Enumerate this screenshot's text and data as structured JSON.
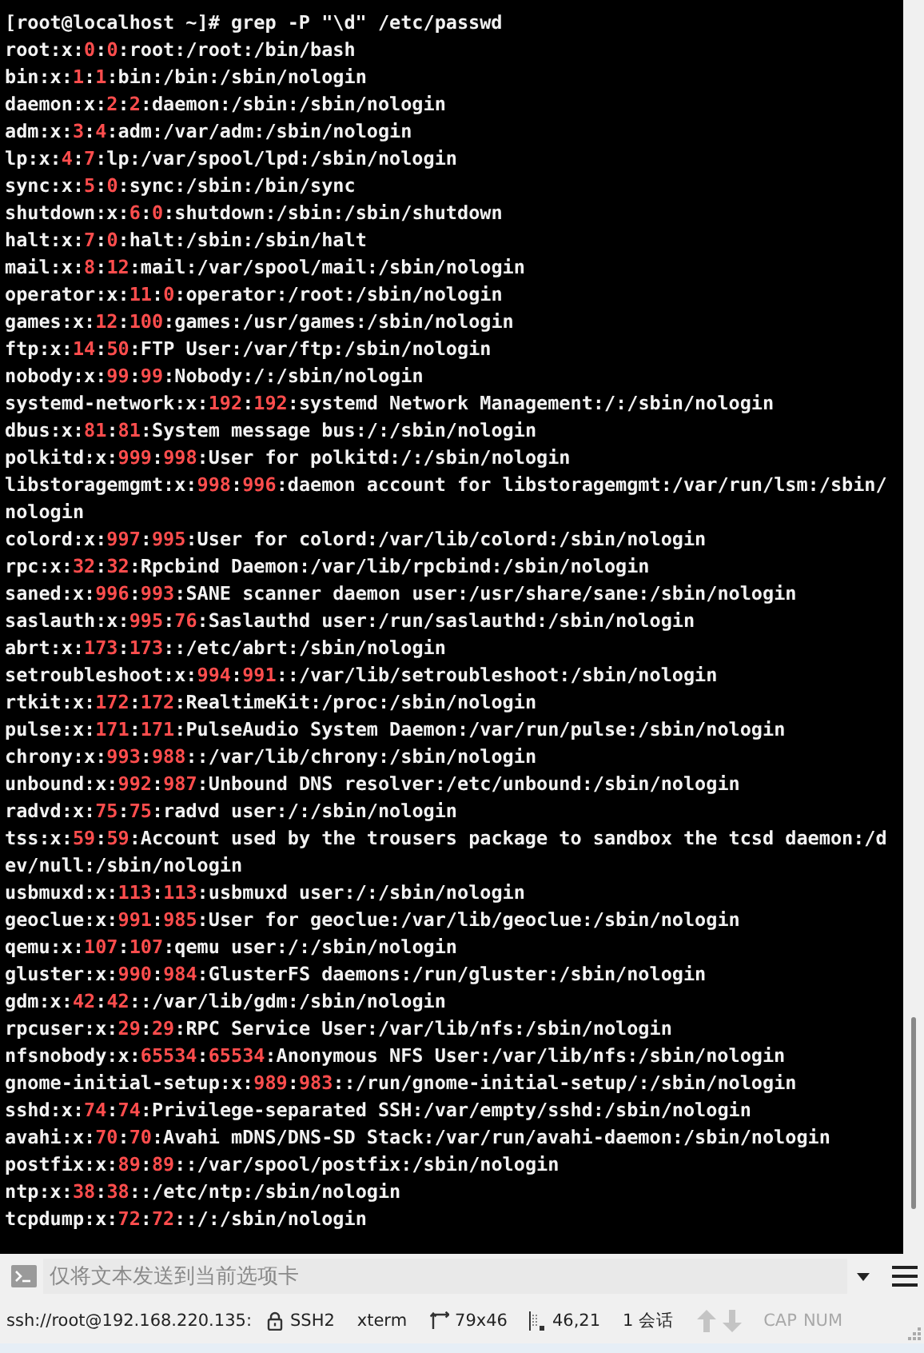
{
  "terminal": {
    "lines": [
      {
        "parts": [
          {
            "text": "[root@localhost ~]# grep -P \"\\d\" /etc/passwd",
            "match": false
          }
        ]
      },
      {
        "parts": [
          {
            "text": "root:x:",
            "match": false
          },
          {
            "text": "0",
            "match": true
          },
          {
            "text": ":",
            "match": false
          },
          {
            "text": "0",
            "match": true
          },
          {
            "text": ":root:/root:/bin/bash",
            "match": false
          }
        ]
      },
      {
        "parts": [
          {
            "text": "bin:x:",
            "match": false
          },
          {
            "text": "1",
            "match": true
          },
          {
            "text": ":",
            "match": false
          },
          {
            "text": "1",
            "match": true
          },
          {
            "text": ":bin:/bin:/sbin/nologin",
            "match": false
          }
        ]
      },
      {
        "parts": [
          {
            "text": "daemon:x:",
            "match": false
          },
          {
            "text": "2",
            "match": true
          },
          {
            "text": ":",
            "match": false
          },
          {
            "text": "2",
            "match": true
          },
          {
            "text": ":daemon:/sbin:/sbin/nologin",
            "match": false
          }
        ]
      },
      {
        "parts": [
          {
            "text": "adm:x:",
            "match": false
          },
          {
            "text": "3",
            "match": true
          },
          {
            "text": ":",
            "match": false
          },
          {
            "text": "4",
            "match": true
          },
          {
            "text": ":adm:/var/adm:/sbin/nologin",
            "match": false
          }
        ]
      },
      {
        "parts": [
          {
            "text": "lp:x:",
            "match": false
          },
          {
            "text": "4",
            "match": true
          },
          {
            "text": ":",
            "match": false
          },
          {
            "text": "7",
            "match": true
          },
          {
            "text": ":lp:/var/spool/lpd:/sbin/nologin",
            "match": false
          }
        ]
      },
      {
        "parts": [
          {
            "text": "sync:x:",
            "match": false
          },
          {
            "text": "5",
            "match": true
          },
          {
            "text": ":",
            "match": false
          },
          {
            "text": "0",
            "match": true
          },
          {
            "text": ":sync:/sbin:/bin/sync",
            "match": false
          }
        ]
      },
      {
        "parts": [
          {
            "text": "shutdown:x:",
            "match": false
          },
          {
            "text": "6",
            "match": true
          },
          {
            "text": ":",
            "match": false
          },
          {
            "text": "0",
            "match": true
          },
          {
            "text": ":shutdown:/sbin:/sbin/shutdown",
            "match": false
          }
        ]
      },
      {
        "parts": [
          {
            "text": "halt:x:",
            "match": false
          },
          {
            "text": "7",
            "match": true
          },
          {
            "text": ":",
            "match": false
          },
          {
            "text": "0",
            "match": true
          },
          {
            "text": ":halt:/sbin:/sbin/halt",
            "match": false
          }
        ]
      },
      {
        "parts": [
          {
            "text": "mail:x:",
            "match": false
          },
          {
            "text": "8",
            "match": true
          },
          {
            "text": ":",
            "match": false
          },
          {
            "text": "12",
            "match": true
          },
          {
            "text": ":mail:/var/spool/mail:/sbin/nologin",
            "match": false
          }
        ]
      },
      {
        "parts": [
          {
            "text": "operator:x:",
            "match": false
          },
          {
            "text": "11",
            "match": true
          },
          {
            "text": ":",
            "match": false
          },
          {
            "text": "0",
            "match": true
          },
          {
            "text": ":operator:/root:/sbin/nologin",
            "match": false
          }
        ]
      },
      {
        "parts": [
          {
            "text": "games:x:",
            "match": false
          },
          {
            "text": "12",
            "match": true
          },
          {
            "text": ":",
            "match": false
          },
          {
            "text": "100",
            "match": true
          },
          {
            "text": ":games:/usr/games:/sbin/nologin",
            "match": false
          }
        ]
      },
      {
        "parts": [
          {
            "text": "ftp:x:",
            "match": false
          },
          {
            "text": "14",
            "match": true
          },
          {
            "text": ":",
            "match": false
          },
          {
            "text": "50",
            "match": true
          },
          {
            "text": ":FTP User:/var/ftp:/sbin/nologin",
            "match": false
          }
        ]
      },
      {
        "parts": [
          {
            "text": "nobody:x:",
            "match": false
          },
          {
            "text": "99",
            "match": true
          },
          {
            "text": ":",
            "match": false
          },
          {
            "text": "99",
            "match": true
          },
          {
            "text": ":Nobody:/:/sbin/nologin",
            "match": false
          }
        ]
      },
      {
        "parts": [
          {
            "text": "systemd-network:x:",
            "match": false
          },
          {
            "text": "192",
            "match": true
          },
          {
            "text": ":",
            "match": false
          },
          {
            "text": "192",
            "match": true
          },
          {
            "text": ":systemd Network Management:/:/sbin/nologin",
            "match": false
          }
        ]
      },
      {
        "parts": [
          {
            "text": "dbus:x:",
            "match": false
          },
          {
            "text": "81",
            "match": true
          },
          {
            "text": ":",
            "match": false
          },
          {
            "text": "81",
            "match": true
          },
          {
            "text": ":System message bus:/:/sbin/nologin",
            "match": false
          }
        ]
      },
      {
        "parts": [
          {
            "text": "polkitd:x:",
            "match": false
          },
          {
            "text": "999",
            "match": true
          },
          {
            "text": ":",
            "match": false
          },
          {
            "text": "998",
            "match": true
          },
          {
            "text": ":User for polkitd:/:/sbin/nologin",
            "match": false
          }
        ]
      },
      {
        "parts": [
          {
            "text": "libstoragemgmt:x:",
            "match": false
          },
          {
            "text": "998",
            "match": true
          },
          {
            "text": ":",
            "match": false
          },
          {
            "text": "996",
            "match": true
          },
          {
            "text": ":daemon account for libstoragemgmt:/var/run/lsm:/sbin/nologin",
            "match": false
          }
        ]
      },
      {
        "parts": [
          {
            "text": "colord:x:",
            "match": false
          },
          {
            "text": "997",
            "match": true
          },
          {
            "text": ":",
            "match": false
          },
          {
            "text": "995",
            "match": true
          },
          {
            "text": ":User for colord:/var/lib/colord:/sbin/nologin",
            "match": false
          }
        ]
      },
      {
        "parts": [
          {
            "text": "rpc:x:",
            "match": false
          },
          {
            "text": "32",
            "match": true
          },
          {
            "text": ":",
            "match": false
          },
          {
            "text": "32",
            "match": true
          },
          {
            "text": ":Rpcbind Daemon:/var/lib/rpcbind:/sbin/nologin",
            "match": false
          }
        ]
      },
      {
        "parts": [
          {
            "text": "saned:x:",
            "match": false
          },
          {
            "text": "996",
            "match": true
          },
          {
            "text": ":",
            "match": false
          },
          {
            "text": "993",
            "match": true
          },
          {
            "text": ":SANE scanner daemon user:/usr/share/sane:/sbin/nologin",
            "match": false
          }
        ]
      },
      {
        "parts": [
          {
            "text": "saslauth:x:",
            "match": false
          },
          {
            "text": "995",
            "match": true
          },
          {
            "text": ":",
            "match": false
          },
          {
            "text": "76",
            "match": true
          },
          {
            "text": ":Saslauthd user:/run/saslauthd:/sbin/nologin",
            "match": false
          }
        ]
      },
      {
        "parts": [
          {
            "text": "abrt:x:",
            "match": false
          },
          {
            "text": "173",
            "match": true
          },
          {
            "text": ":",
            "match": false
          },
          {
            "text": "173",
            "match": true
          },
          {
            "text": "::/etc/abrt:/sbin/nologin",
            "match": false
          }
        ]
      },
      {
        "parts": [
          {
            "text": "setroubleshoot:x:",
            "match": false
          },
          {
            "text": "994",
            "match": true
          },
          {
            "text": ":",
            "match": false
          },
          {
            "text": "991",
            "match": true
          },
          {
            "text": "::/var/lib/setroubleshoot:/sbin/nologin",
            "match": false
          }
        ]
      },
      {
        "parts": [
          {
            "text": "rtkit:x:",
            "match": false
          },
          {
            "text": "172",
            "match": true
          },
          {
            "text": ":",
            "match": false
          },
          {
            "text": "172",
            "match": true
          },
          {
            "text": ":RealtimeKit:/proc:/sbin/nologin",
            "match": false
          }
        ]
      },
      {
        "parts": [
          {
            "text": "pulse:x:",
            "match": false
          },
          {
            "text": "171",
            "match": true
          },
          {
            "text": ":",
            "match": false
          },
          {
            "text": "171",
            "match": true
          },
          {
            "text": ":PulseAudio System Daemon:/var/run/pulse:/sbin/nologin",
            "match": false
          }
        ]
      },
      {
        "parts": [
          {
            "text": "chrony:x:",
            "match": false
          },
          {
            "text": "993",
            "match": true
          },
          {
            "text": ":",
            "match": false
          },
          {
            "text": "988",
            "match": true
          },
          {
            "text": "::/var/lib/chrony:/sbin/nologin",
            "match": false
          }
        ]
      },
      {
        "parts": [
          {
            "text": "unbound:x:",
            "match": false
          },
          {
            "text": "992",
            "match": true
          },
          {
            "text": ":",
            "match": false
          },
          {
            "text": "987",
            "match": true
          },
          {
            "text": ":Unbound DNS resolver:/etc/unbound:/sbin/nologin",
            "match": false
          }
        ]
      },
      {
        "parts": [
          {
            "text": "radvd:x:",
            "match": false
          },
          {
            "text": "75",
            "match": true
          },
          {
            "text": ":",
            "match": false
          },
          {
            "text": "75",
            "match": true
          },
          {
            "text": ":radvd user:/:/sbin/nologin",
            "match": false
          }
        ]
      },
      {
        "parts": [
          {
            "text": "tss:x:",
            "match": false
          },
          {
            "text": "59",
            "match": true
          },
          {
            "text": ":",
            "match": false
          },
          {
            "text": "59",
            "match": true
          },
          {
            "text": ":Account used by the trousers package to sandbox the tcsd daemon:/dev/null:/sbin/nologin",
            "match": false
          }
        ]
      },
      {
        "parts": [
          {
            "text": "usbmuxd:x:",
            "match": false
          },
          {
            "text": "113",
            "match": true
          },
          {
            "text": ":",
            "match": false
          },
          {
            "text": "113",
            "match": true
          },
          {
            "text": ":usbmuxd user:/:/sbin/nologin",
            "match": false
          }
        ]
      },
      {
        "parts": [
          {
            "text": "geoclue:x:",
            "match": false
          },
          {
            "text": "991",
            "match": true
          },
          {
            "text": ":",
            "match": false
          },
          {
            "text": "985",
            "match": true
          },
          {
            "text": ":User for geoclue:/var/lib/geoclue:/sbin/nologin",
            "match": false
          }
        ]
      },
      {
        "parts": [
          {
            "text": "qemu:x:",
            "match": false
          },
          {
            "text": "107",
            "match": true
          },
          {
            "text": ":",
            "match": false
          },
          {
            "text": "107",
            "match": true
          },
          {
            "text": ":qemu user:/:/sbin/nologin",
            "match": false
          }
        ]
      },
      {
        "parts": [
          {
            "text": "gluster:x:",
            "match": false
          },
          {
            "text": "990",
            "match": true
          },
          {
            "text": ":",
            "match": false
          },
          {
            "text": "984",
            "match": true
          },
          {
            "text": ":GlusterFS daemons:/run/gluster:/sbin/nologin",
            "match": false
          }
        ]
      },
      {
        "parts": [
          {
            "text": "gdm:x:",
            "match": false
          },
          {
            "text": "42",
            "match": true
          },
          {
            "text": ":",
            "match": false
          },
          {
            "text": "42",
            "match": true
          },
          {
            "text": "::/var/lib/gdm:/sbin/nologin",
            "match": false
          }
        ]
      },
      {
        "parts": [
          {
            "text": "rpcuser:x:",
            "match": false
          },
          {
            "text": "29",
            "match": true
          },
          {
            "text": ":",
            "match": false
          },
          {
            "text": "29",
            "match": true
          },
          {
            "text": ":RPC Service User:/var/lib/nfs:/sbin/nologin",
            "match": false
          }
        ]
      },
      {
        "parts": [
          {
            "text": "nfsnobody:x:",
            "match": false
          },
          {
            "text": "65534",
            "match": true
          },
          {
            "text": ":",
            "match": false
          },
          {
            "text": "65534",
            "match": true
          },
          {
            "text": ":Anonymous NFS User:/var/lib/nfs:/sbin/nologin",
            "match": false
          }
        ]
      },
      {
        "parts": [
          {
            "text": "gnome-initial-setup:x:",
            "match": false
          },
          {
            "text": "989",
            "match": true
          },
          {
            "text": ":",
            "match": false
          },
          {
            "text": "983",
            "match": true
          },
          {
            "text": "::/run/gnome-initial-setup/:/sbin/nologin",
            "match": false
          }
        ]
      },
      {
        "parts": [
          {
            "text": "sshd:x:",
            "match": false
          },
          {
            "text": "74",
            "match": true
          },
          {
            "text": ":",
            "match": false
          },
          {
            "text": "74",
            "match": true
          },
          {
            "text": ":Privilege-separated SSH:/var/empty/sshd:/sbin/nologin",
            "match": false
          }
        ]
      },
      {
        "parts": [
          {
            "text": "avahi:x:",
            "match": false
          },
          {
            "text": "70",
            "match": true
          },
          {
            "text": ":",
            "match": false
          },
          {
            "text": "70",
            "match": true
          },
          {
            "text": ":Avahi mDNS/DNS-SD Stack:/var/run/avahi-daemon:/sbin/nologin",
            "match": false
          }
        ]
      },
      {
        "parts": [
          {
            "text": "postfix:x:",
            "match": false
          },
          {
            "text": "89",
            "match": true
          },
          {
            "text": ":",
            "match": false
          },
          {
            "text": "89",
            "match": true
          },
          {
            "text": "::/var/spool/postfix:/sbin/nologin",
            "match": false
          }
        ]
      },
      {
        "parts": [
          {
            "text": "ntp:x:",
            "match": false
          },
          {
            "text": "38",
            "match": true
          },
          {
            "text": ":",
            "match": false
          },
          {
            "text": "38",
            "match": true
          },
          {
            "text": "::/etc/ntp:/sbin/nologin",
            "match": false
          }
        ]
      },
      {
        "parts": [
          {
            "text": "tcpdump:x:",
            "match": false
          },
          {
            "text": "72",
            "match": true
          },
          {
            "text": ":",
            "match": false
          },
          {
            "text": "72",
            "match": true
          },
          {
            "text": "::/:/sbin/nologin",
            "match": false
          }
        ]
      }
    ]
  },
  "send_bar": {
    "placeholder": "仅将文本发送到当前选项卡"
  },
  "status_bar": {
    "connection": "ssh://root@192.168.220.135:",
    "protocol": "SSH2",
    "terminal_type": "xterm",
    "size": "79x46",
    "cursor": "46,21",
    "sessions": "1 会话",
    "nav_disabled": true,
    "keys": [
      {
        "label": "CAP",
        "on": false
      },
      {
        "label": "NUM",
        "on": false
      }
    ]
  }
}
